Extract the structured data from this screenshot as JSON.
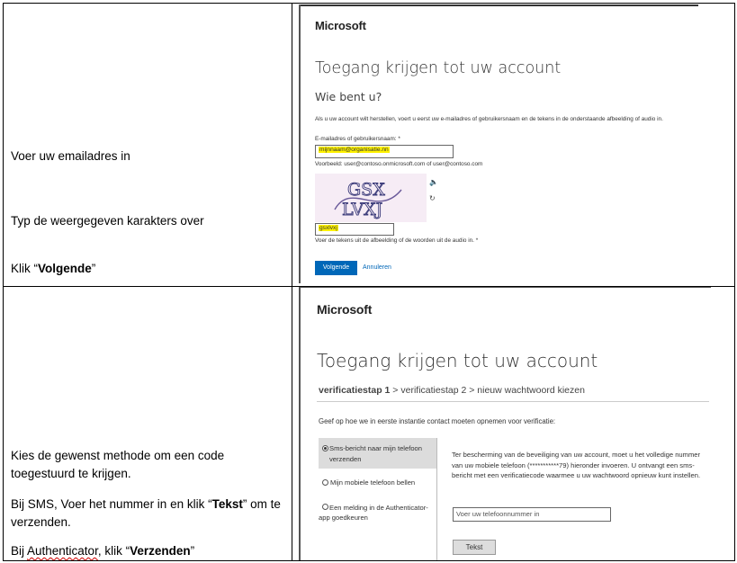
{
  "left": {
    "row1": {
      "step1": "Voer uw emailadres in",
      "step2": "Typ de weergegeven karakters over",
      "step3_prefix": "Klik “",
      "step3_bold": "Volgende",
      "step3_suffix": "”"
    },
    "row2": {
      "line1": "Kies de gewenst methode om een code toegestuurd te krijgen.",
      "line2_prefix": "Bij SMS, Voer het nummer in en klik “",
      "line2_bold": "Tekst",
      "line2_suffix": "” om te verzenden.",
      "line3_prefix": "Bij ",
      "line3_squiggle": "Authenticator",
      "line3_mid": ", klik “",
      "line3_bold": "Verzenden",
      "line3_suffix": "”"
    }
  },
  "shot1": {
    "brand": "Microsoft",
    "title": "Toegang krijgen tot uw account",
    "subtitle": "Wie bent u?",
    "intro": "Als u uw account wilt herstellen, voert u eerst uw e-mailadres of gebruikersnaam en de tekens in de onderstaande afbeelding of audio in.",
    "email_label": "E-mailadres of gebruikersnaam: *",
    "email_value": "mijnnaam@organisatie.nn",
    "example": "Voorbeeld: user@contoso.onmicrosoft.com of user@contoso.com",
    "captcha_text": "GSX LVXJ",
    "captcha_value": "gsxlvxj",
    "captcha_hint": "Voer de tekens uit de afbeelding of de woorden uit de audio in. *",
    "next_button": "Volgende",
    "cancel_link": "Annuleren",
    "speaker_icon": "speaker-icon",
    "refresh_icon": "refresh-icon"
  },
  "shot2": {
    "brand": "Microsoft",
    "title": "Toegang krijgen tot uw account",
    "step_current": "verificatiestap 1",
    "step_sep1": " > ",
    "step2": "verificatiestap 2",
    "step_sep2": " > ",
    "step3": "nieuw wachtwoord kiezen",
    "question": "Geef op hoe we in eerste instantie contact moeten opnemen voor verificatie:",
    "options": [
      "Sms-bericht naar mijn telefoon verzenden",
      "Mijn mobiele telefoon bellen",
      "Een melding in de Authenticator-app goedkeuren"
    ],
    "selected_option": 0,
    "explanation": "Ter bescherming van de beveiliging van uw account, moet u het volledige nummer van uw mobiele telefoon (***********79) hieronder invoeren. U ontvangt een sms-bericht met een verificatiecode waarmee u uw wachtwoord opnieuw kunt instellen.",
    "phone_placeholder": "Voer uw telefoonnummer in",
    "text_button": "Tekst"
  },
  "colors": {
    "accent": "#0067b8",
    "highlight": "#fff200",
    "selected_bg": "#dcdcdc"
  }
}
